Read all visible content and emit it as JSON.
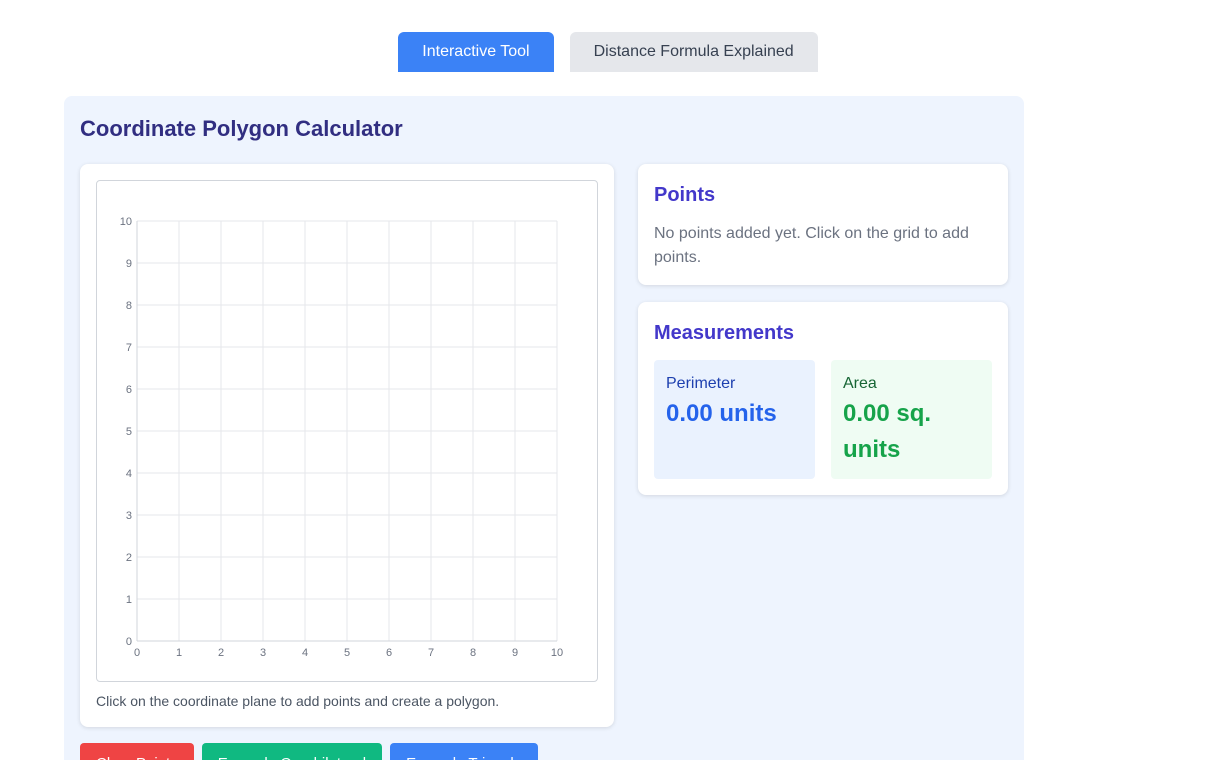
{
  "tabs": [
    {
      "label": "Interactive Tool"
    },
    {
      "label": "Distance Formula Explained"
    }
  ],
  "page_title": "Coordinate Polygon Calculator",
  "grid": {
    "x_min": 0,
    "x_max": 10,
    "y_min": 0,
    "y_max": 10,
    "x_ticks": [
      "0",
      "1",
      "2",
      "3",
      "4",
      "5",
      "6",
      "7",
      "8",
      "9",
      "10"
    ],
    "y_ticks": [
      "0",
      "1",
      "2",
      "3",
      "4",
      "5",
      "6",
      "7",
      "8",
      "9",
      "10"
    ],
    "help_text": "Click on the coordinate plane to add points and create a polygon."
  },
  "points": {
    "title": "Points",
    "empty_text": "No points added yet. Click on the grid to add points."
  },
  "measurements": {
    "title": "Measurements",
    "perimeter_label": "Perimeter",
    "perimeter_value": "0.00 units",
    "area_label": "Area",
    "area_value": "0.00 sq. units"
  },
  "buttons": {
    "clear": "Clear Points",
    "quadrilateral": "Example Quadrilateral",
    "triangle": "Example Triangle"
  },
  "colors": {
    "primary": "#3b82f6",
    "danger": "#ef4444",
    "success": "#10b981"
  }
}
